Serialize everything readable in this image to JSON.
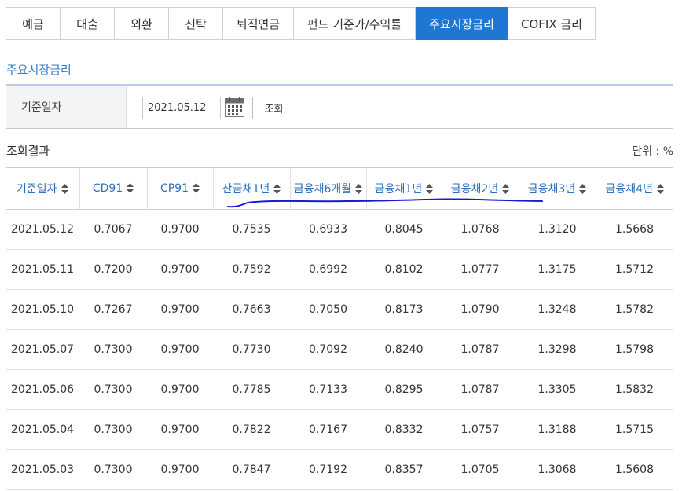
{
  "tabs": [
    {
      "label": "예금",
      "active": false
    },
    {
      "label": "대출",
      "active": false
    },
    {
      "label": "외환",
      "active": false
    },
    {
      "label": "신탁",
      "active": false
    },
    {
      "label": "퇴직연금",
      "active": false
    },
    {
      "label": "펀드 기준가/수익률",
      "active": false
    },
    {
      "label": "주요시장금리",
      "active": true
    },
    {
      "label": "COFIX 금리",
      "active": false
    }
  ],
  "section_title": "주요시장금리",
  "search": {
    "label": "기준일자",
    "date_value": "2021.05.12",
    "button_label": "조회"
  },
  "result": {
    "title": "조회결과",
    "unit": "단위 : %"
  },
  "table": {
    "columns": [
      "기준일자",
      "CD91",
      "CP91",
      "산금채1년",
      "금융채6개월",
      "금융채1년",
      "금융채2년",
      "금융채3년",
      "금융채4년"
    ],
    "rows": [
      [
        "2021.05.12",
        "0.7067",
        "0.9700",
        "0.7535",
        "0.6933",
        "0.8045",
        "1.0768",
        "1.3120",
        "1.5668"
      ],
      [
        "2021.05.11",
        "0.7200",
        "0.9700",
        "0.7592",
        "0.6992",
        "0.8102",
        "1.0777",
        "1.3175",
        "1.5712"
      ],
      [
        "2021.05.10",
        "0.7267",
        "0.9700",
        "0.7663",
        "0.7050",
        "0.8173",
        "1.0790",
        "1.3248",
        "1.5782"
      ],
      [
        "2021.05.07",
        "0.7300",
        "0.9700",
        "0.7730",
        "0.7092",
        "0.8240",
        "1.0787",
        "1.3298",
        "1.5798"
      ],
      [
        "2021.05.06",
        "0.7300",
        "0.9700",
        "0.7785",
        "0.7133",
        "0.8295",
        "1.0787",
        "1.3305",
        "1.5832"
      ],
      [
        "2021.05.04",
        "0.7300",
        "0.9700",
        "0.7822",
        "0.7167",
        "0.8332",
        "1.0757",
        "1.3188",
        "1.5715"
      ],
      [
        "2021.05.03",
        "0.7300",
        "0.9700",
        "0.7847",
        "0.7192",
        "0.8357",
        "1.0705",
        "1.3068",
        "1.5608"
      ]
    ]
  },
  "colors": {
    "accent": "#1f77d4",
    "header_text": "#2e6fb8",
    "annotation": "#1a1ad6"
  }
}
